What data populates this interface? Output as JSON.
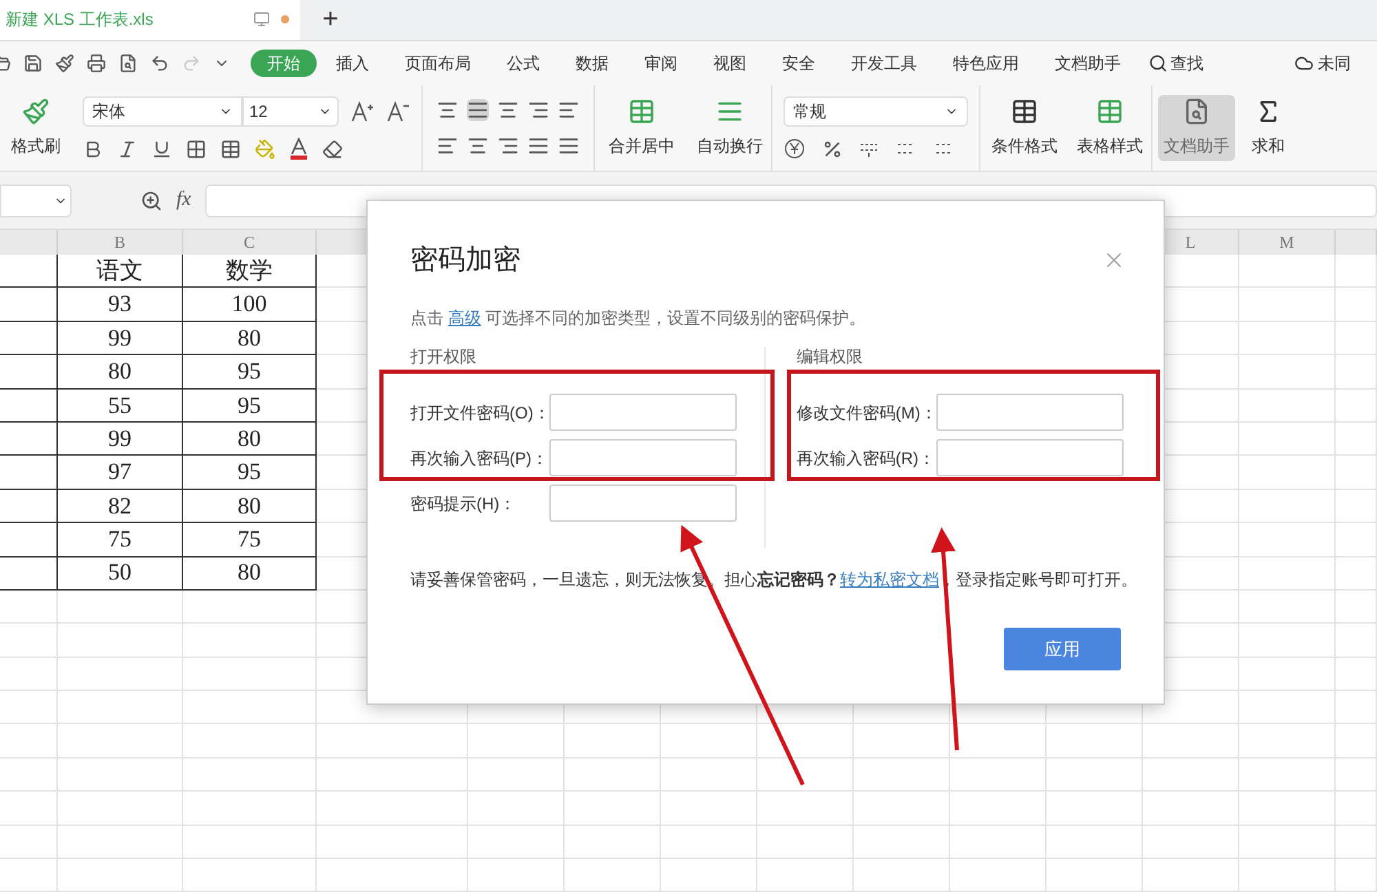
{
  "document_tab": {
    "title": "新建 XLS 工作表.xls",
    "unsaved": true
  },
  "new_tab_button": "+",
  "menu_tabs": [
    {
      "label": "开始",
      "selected": true
    },
    {
      "label": "插入",
      "selected": false
    },
    {
      "label": "页面布局",
      "selected": false
    },
    {
      "label": "公式",
      "selected": false
    },
    {
      "label": "数据",
      "selected": false
    },
    {
      "label": "审阅",
      "selected": false
    },
    {
      "label": "视图",
      "selected": false
    },
    {
      "label": "安全",
      "selected": false
    },
    {
      "label": "开发工具",
      "selected": false
    },
    {
      "label": "特色应用",
      "selected": false
    },
    {
      "label": "文档助手",
      "selected": false
    }
  ],
  "search": "查找",
  "sync_status": "未同",
  "ribbon": {
    "format_painter": "格式刷",
    "font": "宋体",
    "font_size": "12",
    "merge": "合并居中",
    "wrap": "自动换行",
    "number_format": "常规",
    "conditional_format": "条件格式",
    "table_style": "表格样式",
    "doc_assistant": {
      "label": "文档助手",
      "selected": true
    },
    "sum": "求和"
  },
  "formula_bar": {
    "fx": "fx"
  },
  "sheet": {
    "column_headers": [
      "B",
      "C",
      "L",
      "M"
    ],
    "rows": [
      [
        "语文",
        "数学"
      ],
      [
        "93",
        "100"
      ],
      [
        "99",
        "80"
      ],
      [
        "80",
        "95"
      ],
      [
        "55",
        "95"
      ],
      [
        "99",
        "80"
      ],
      [
        "97",
        "95"
      ],
      [
        "82",
        "80"
      ],
      [
        "75",
        "75"
      ],
      [
        "50",
        "80"
      ]
    ]
  },
  "dialog": {
    "title": "密码加密",
    "description": {
      "before": "点击",
      "link": "高级",
      "after": "可选择不同的加密类型，设置不同级别的密码保护。"
    },
    "sections": [
      {
        "title": "打开权限",
        "fields": [
          {
            "label": "打开文件密码(O)："
          },
          {
            "label": "再次输入密码(P)："
          },
          {
            "label": "密码提示(H)："
          }
        ]
      },
      {
        "title": "编辑权限",
        "fields": [
          {
            "label": "修改文件密码(M)："
          },
          {
            "label": "再次输入密码(R)："
          }
        ]
      }
    ],
    "note": {
      "before": "请妥善保管密码，一旦遗忘，则无法恢复。担心**忘记密码？**",
      "link": "转为私密文档",
      "after": "，登录指定账号即可打开。"
    },
    "apply_button": "应用"
  }
}
